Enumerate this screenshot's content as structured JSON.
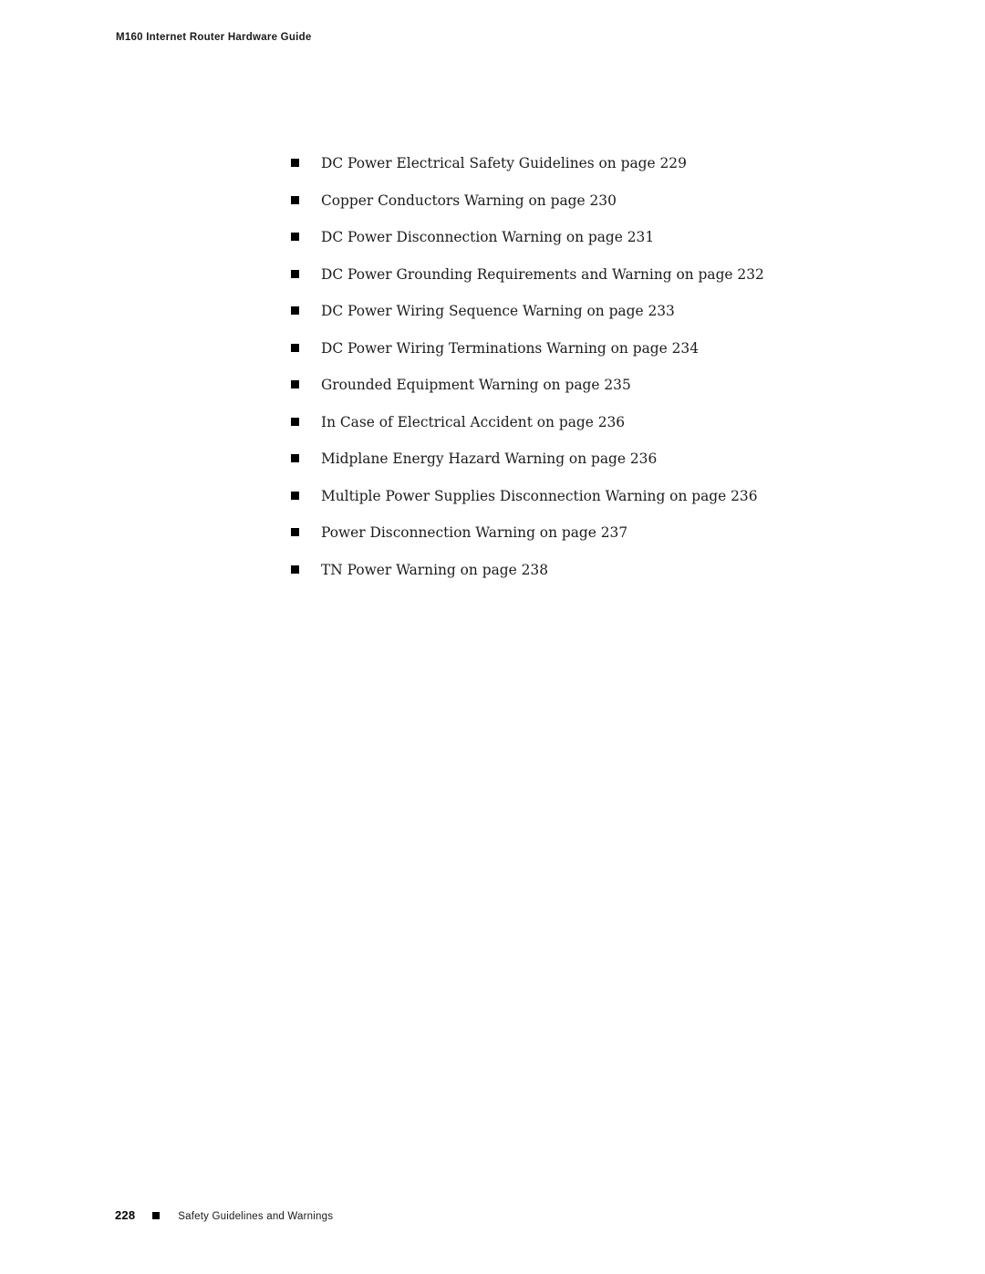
{
  "document": {
    "running_header": "M160 Internet Router Hardware Guide"
  },
  "main": {
    "bullet_glyph": "square-bullet",
    "items": [
      {
        "label": "DC Power Electrical Safety Guidelines on page 229"
      },
      {
        "label": "Copper Conductors Warning on page 230"
      },
      {
        "label": "DC Power Disconnection Warning on page 231"
      },
      {
        "label": "DC Power Grounding Requirements and Warning on page 232"
      },
      {
        "label": "DC Power Wiring Sequence Warning on page 233"
      },
      {
        "label": "DC Power Wiring Terminations Warning on page 234"
      },
      {
        "label": "Grounded Equipment Warning on page 235"
      },
      {
        "label": "In Case of Electrical Accident on page 236"
      },
      {
        "label": "Midplane Energy Hazard Warning on page 236"
      },
      {
        "label": "Multiple Power Supplies Disconnection Warning on page 236"
      },
      {
        "label": "Power Disconnection Warning on page 237"
      },
      {
        "label": "TN Power Warning on page 238"
      }
    ]
  },
  "footer": {
    "page_number": "228",
    "separator_glyph": "square-bullet",
    "chapter_title": "Safety Guidelines and Warnings"
  }
}
